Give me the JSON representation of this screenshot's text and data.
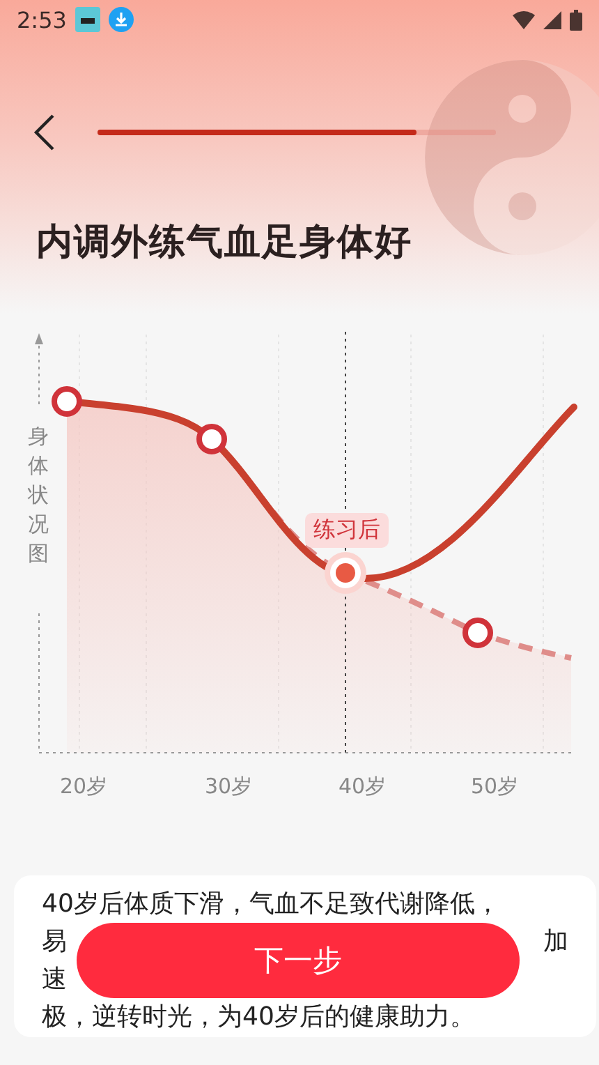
{
  "status_bar": {
    "time": "2:53"
  },
  "header": {
    "progress": {
      "level": 0.8
    },
    "title": "内调外练气血足身体好"
  },
  "chart": {
    "y_label": "身体状况图",
    "x_labels": [
      "20岁",
      "30岁",
      "40岁",
      "50岁"
    ],
    "tag": "练习后"
  },
  "info_card": {
    "lines": [
      {
        "left": "40岁后体质下滑，气血不足致代谢降低，"
      },
      {
        "left": "易",
        "right": "加"
      },
      {
        "left": "速"
      },
      {
        "left": "极，逆转时光，为40岁后的健康助力。"
      }
    ]
  },
  "next_button": {
    "label": "下一步"
  }
}
